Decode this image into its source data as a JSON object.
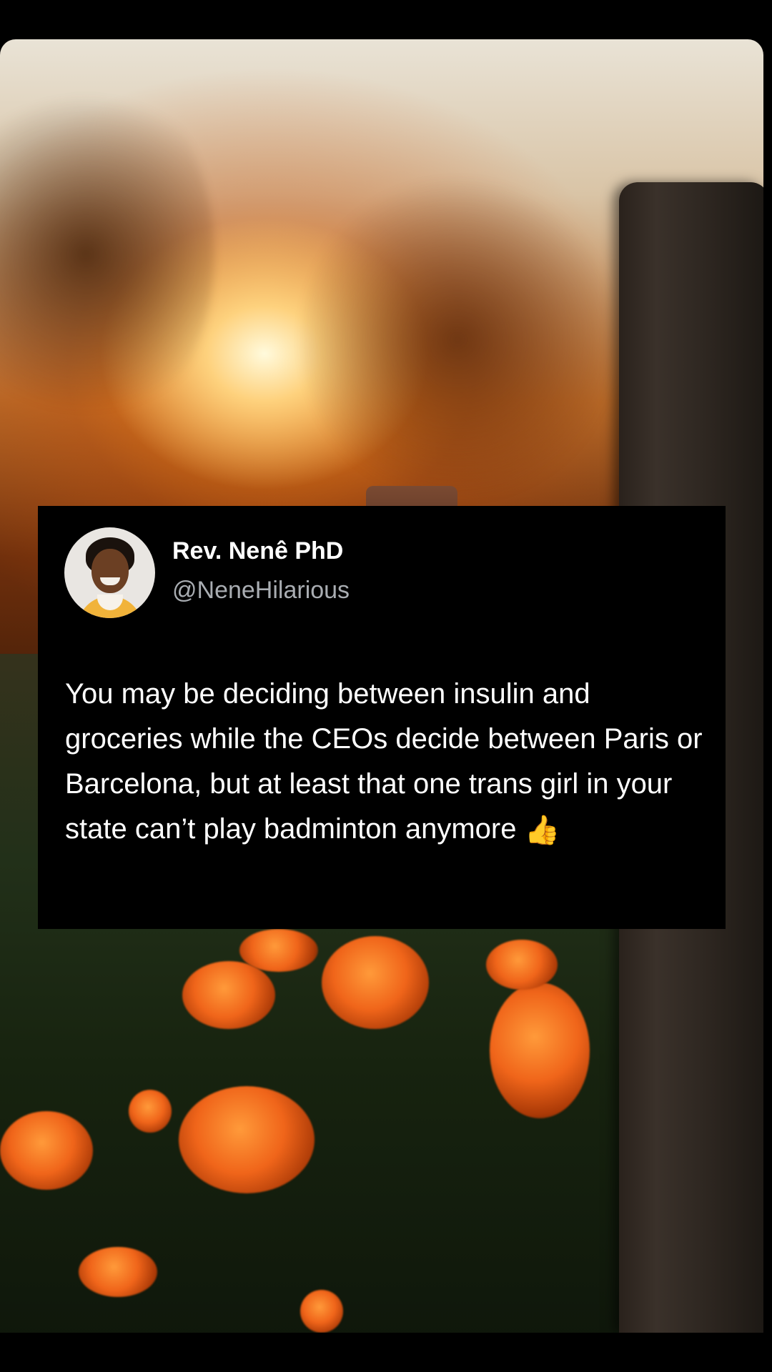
{
  "tweet": {
    "display_name": "Rev. Nenê PhD",
    "handle": "@NeneHilarious",
    "text": "You may be deciding between insulin and groceries while the CEOs decide between Paris or Barcelona, but at least that one trans girl in your state can’t play badminton anymore",
    "emoji": "👍",
    "emoji_icon": "thumbs-up-icon",
    "avatar_icon": "avatar"
  },
  "colors": {
    "card_background": "#000000",
    "name_text": "#ffffff",
    "handle_text": "#a9adb2",
    "sunset_orange": "#f0651a"
  }
}
